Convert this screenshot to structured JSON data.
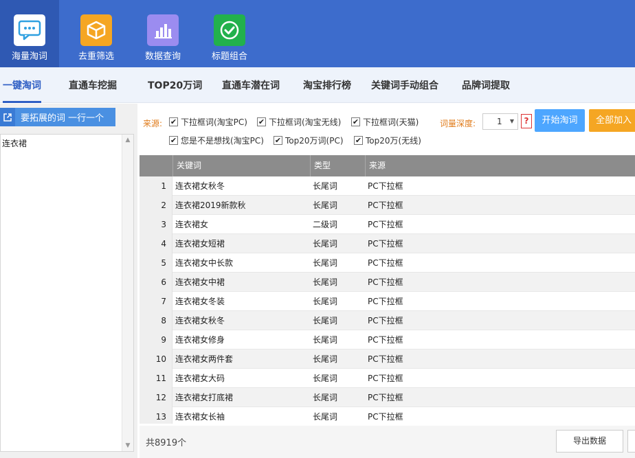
{
  "toolbar": {
    "items": [
      {
        "label": "海量淘词",
        "icon": "chat-bubble-icon",
        "active": true
      },
      {
        "label": "去重筛选",
        "icon": "box-icon"
      },
      {
        "label": "数据查询",
        "icon": "bar-chart-icon"
      },
      {
        "label": "标题组合",
        "icon": "check-circle-icon"
      }
    ]
  },
  "tabs": [
    {
      "label": "一键淘词",
      "active": true
    },
    {
      "label": "直通车挖掘"
    },
    {
      "label": "TOP20万词"
    },
    {
      "label": "直通车潜在词"
    },
    {
      "label": "淘宝排行榜"
    },
    {
      "label": "关键词手动组合"
    },
    {
      "label": "品牌词提取"
    }
  ],
  "left": {
    "expand_label": "要拓展的词 一行一个",
    "words": "连衣裙"
  },
  "options": {
    "source_label": "来源:",
    "sources": [
      {
        "label": "下拉框词(淘宝PC)",
        "checked": true
      },
      {
        "label": "下拉框词(淘宝无线)",
        "checked": true
      },
      {
        "label": "下拉框词(天猫)",
        "checked": true
      },
      {
        "label": "您是不是想找(淘宝PC)",
        "checked": true
      },
      {
        "label": "Top20万词(PC)",
        "checked": true
      },
      {
        "label": "Top20万(无线)",
        "checked": true
      }
    ],
    "depth_label": "词量深度:",
    "depth_value": "1",
    "help": "?",
    "start_label": "开始淘词",
    "addall_label": "全部加入"
  },
  "table": {
    "columns": [
      "关键词",
      "类型",
      "来源"
    ],
    "rows": [
      {
        "num": "1",
        "keyword": "连衣裙女秋冬",
        "type": "长尾词",
        "source": "PC下拉框"
      },
      {
        "num": "2",
        "keyword": "连衣裙2019新款秋",
        "type": "长尾词",
        "source": "PC下拉框"
      },
      {
        "num": "3",
        "keyword": "连衣裙女",
        "type": "二级词",
        "source": "PC下拉框"
      },
      {
        "num": "4",
        "keyword": "连衣裙女短裙",
        "type": "长尾词",
        "source": "PC下拉框"
      },
      {
        "num": "5",
        "keyword": "连衣裙女中长款",
        "type": "长尾词",
        "source": "PC下拉框"
      },
      {
        "num": "6",
        "keyword": "连衣裙女中裙",
        "type": "长尾词",
        "source": "PC下拉框"
      },
      {
        "num": "7",
        "keyword": "连衣裙女冬装",
        "type": "长尾词",
        "source": "PC下拉框"
      },
      {
        "num": "8",
        "keyword": "连衣裙女秋冬",
        "type": "长尾词",
        "source": "PC下拉框"
      },
      {
        "num": "9",
        "keyword": "连衣裙女修身",
        "type": "长尾词",
        "source": "PC下拉框"
      },
      {
        "num": "10",
        "keyword": "连衣裙女两件套",
        "type": "长尾词",
        "source": "PC下拉框"
      },
      {
        "num": "11",
        "keyword": "连衣裙女大码",
        "type": "长尾词",
        "source": "PC下拉框"
      },
      {
        "num": "12",
        "keyword": "连衣裙女打底裙",
        "type": "长尾词",
        "source": "PC下拉框"
      },
      {
        "num": "13",
        "keyword": "连衣裙女长袖",
        "type": "长尾词",
        "source": "PC下拉框"
      }
    ]
  },
  "footer": {
    "total": "共8919个",
    "export_label": "导出数据"
  }
}
